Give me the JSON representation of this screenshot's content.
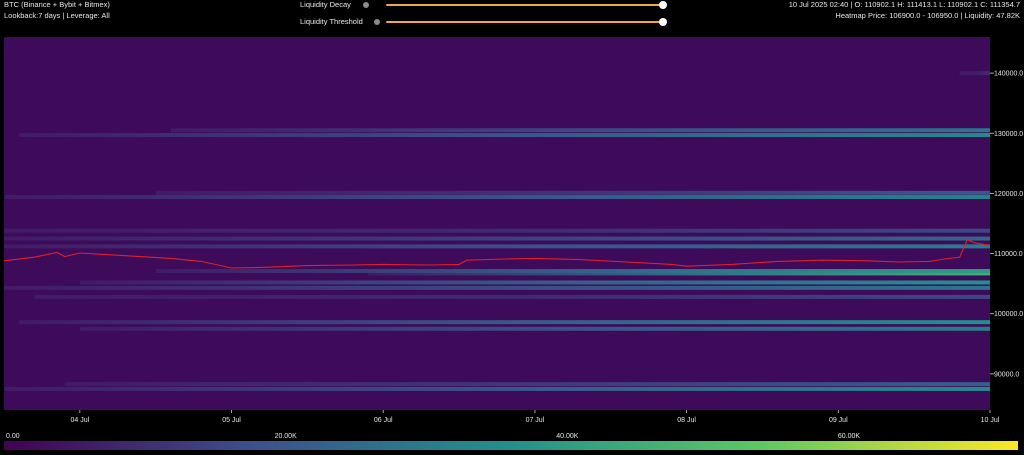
{
  "header": {
    "title": "BTC (Binance + Bybit + Bitmex)",
    "subtitle": "Lookback:7 days | Leverage: All",
    "ohlc": "10 Jul 2025 02:40 | O: 110902.1 H: 111413.1 L: 110902.1 C: 111354.7",
    "heatmap_info": "Heatmap Price: 106900.0 - 106950.0 | Liquidity: 47.82K"
  },
  "controls": {
    "liquidity_decay": {
      "label": "Liquidity Decay",
      "value": 1.0
    },
    "liquidity_threshold": {
      "label": "Liquidity Threshold",
      "value": 1.0
    }
  },
  "colors": {
    "background": "#000000",
    "heatmap_base": "#3e0a5a",
    "price_line": "#e0202a",
    "slider_track": "#f0a64a",
    "colormap": [
      "#440154",
      "#3b528b",
      "#21918c",
      "#5ec962",
      "#fde725"
    ]
  },
  "chart_data": {
    "type": "heatmap",
    "x_ticks": [
      "04 Jul",
      "05 Jul",
      "06 Jul",
      "07 Jul",
      "08 Jul",
      "09 Jul",
      "10 Jul"
    ],
    "y_ticks": [
      "90000.0",
      "100000.0",
      "110000.0",
      "120000.0",
      "130000.0",
      "140000.0"
    ],
    "y_tick_values": [
      90000,
      100000,
      110000,
      120000,
      130000,
      140000
    ],
    "ylim": [
      84000,
      146000
    ],
    "x_range_days": [
      3.5,
      10.0
    ],
    "colorbar": {
      "ticks": [
        "0.00",
        "20.00K",
        "40.00K",
        "60.00K"
      ],
      "tick_values": [
        0,
        20000,
        40000,
        60000
      ],
      "max": 72000
    },
    "liquidity_bands": [
      {
        "price": 87500,
        "start_day": 3.5,
        "liquidity": 34000
      },
      {
        "price": 88300,
        "start_day": 3.9,
        "liquidity": 22000
      },
      {
        "price": 97500,
        "start_day": 4.0,
        "liquidity": 30000
      },
      {
        "price": 98600,
        "start_day": 3.6,
        "liquidity": 36000
      },
      {
        "price": 102800,
        "start_day": 3.7,
        "liquidity": 16000
      },
      {
        "price": 104300,
        "start_day": 3.5,
        "liquidity": 28000
      },
      {
        "price": 105200,
        "start_day": 4.0,
        "liquidity": 36000
      },
      {
        "price": 106700,
        "start_day": 5.9,
        "liquidity": 46000
      },
      {
        "price": 107100,
        "start_day": 4.5,
        "liquidity": 40000
      },
      {
        "price": 111200,
        "start_day": 3.5,
        "liquidity": 30000
      },
      {
        "price": 112500,
        "start_day": 3.5,
        "liquidity": 24000
      },
      {
        "price": 113800,
        "start_day": 3.5,
        "liquidity": 16000
      },
      {
        "price": 119400,
        "start_day": 3.5,
        "liquidity": 32000
      },
      {
        "price": 120100,
        "start_day": 4.5,
        "liquidity": 20000
      },
      {
        "price": 129700,
        "start_day": 3.6,
        "liquidity": 34000
      },
      {
        "price": 130500,
        "start_day": 4.6,
        "liquidity": 28000
      },
      {
        "price": 140000,
        "start_day": 9.8,
        "liquidity": 10000
      }
    ],
    "price_series": {
      "name": "",
      "x_days": [
        3.5,
        3.7,
        3.85,
        3.9,
        4.0,
        4.2,
        4.4,
        4.6,
        4.8,
        5.0,
        5.2,
        5.5,
        5.8,
        6.0,
        6.3,
        6.5,
        6.55,
        6.8,
        7.0,
        7.3,
        7.6,
        7.9,
        8.0,
        8.3,
        8.6,
        8.9,
        9.2,
        9.4,
        9.6,
        9.7,
        9.8,
        9.85,
        9.9,
        10.0
      ],
      "values": [
        108800,
        109400,
        110200,
        109500,
        110100,
        109800,
        109500,
        109200,
        108700,
        107600,
        107700,
        108000,
        108100,
        108200,
        108100,
        108200,
        108900,
        109100,
        109200,
        109000,
        108600,
        108200,
        107900,
        108200,
        108700,
        108900,
        108800,
        108600,
        108700,
        109100,
        109400,
        112300,
        111800,
        111350
      ]
    }
  }
}
